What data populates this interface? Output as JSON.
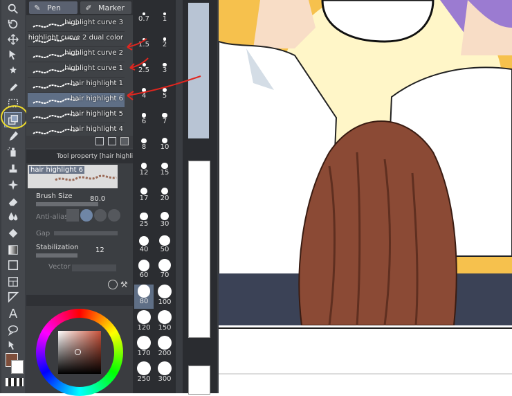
{
  "tabs": {
    "pen_label": "Pen",
    "marker_label": "Marker"
  },
  "brushes": [
    {
      "label": "highlight curve 3"
    },
    {
      "label": "highlight curve 2 dual color"
    },
    {
      "label": "highlight curve 2"
    },
    {
      "label": "highlight curve 1"
    },
    {
      "label": "hair highlight 1"
    },
    {
      "label": "hair highlight 6",
      "selected": true
    },
    {
      "label": "hair highlight 5"
    },
    {
      "label": "hair highlight 4"
    }
  ],
  "tool_property": {
    "title": "Tool property [hair highlig",
    "preview_name": "hair highlight 6",
    "brush_size_label": "Brush Size",
    "brush_size_value": "80.0",
    "antialias_label": "Anti-aliasi",
    "gap_label": "Gap",
    "stabilization_label": "Stabilization",
    "stabilization_value": "12",
    "vector_label": "Vector m"
  },
  "sizes": [
    [
      "0.7",
      "1"
    ],
    [
      "1.5",
      "2"
    ],
    [
      "2.5",
      "3"
    ],
    [
      "4",
      "5"
    ],
    [
      "6",
      "7"
    ],
    [
      "8",
      "10"
    ],
    [
      "12",
      "15"
    ],
    [
      "17",
      "20"
    ],
    [
      "25",
      "30"
    ],
    [
      "40",
      "50"
    ],
    [
      "60",
      "70"
    ],
    [
      "80",
      "100"
    ],
    [
      "120",
      "150"
    ],
    [
      "170",
      "200"
    ],
    [
      "250",
      "300"
    ]
  ],
  "selected_size": "80",
  "colors": {
    "main": "#7e4e3b",
    "sub": "#ffffff",
    "accent": "#5f6f86",
    "annotation": "#e0261f",
    "highlight_ring": "#f0dd2a"
  },
  "icons": [
    "zoom-icon",
    "rotate-icon",
    "move-icon",
    "object-icon",
    "magic-wand-icon",
    "eyedropper-icon",
    "selection-icon",
    "layer-move-icon",
    "pen-icon",
    "airbrush-icon",
    "stamp-icon",
    "sparkle-icon",
    "eraser-icon",
    "blend-icon",
    "fill-icon",
    "gradient-icon",
    "figure-icon",
    "frame-icon",
    "ruler-icon",
    "text-icon",
    "balloon-icon",
    "correct-line-icon"
  ]
}
